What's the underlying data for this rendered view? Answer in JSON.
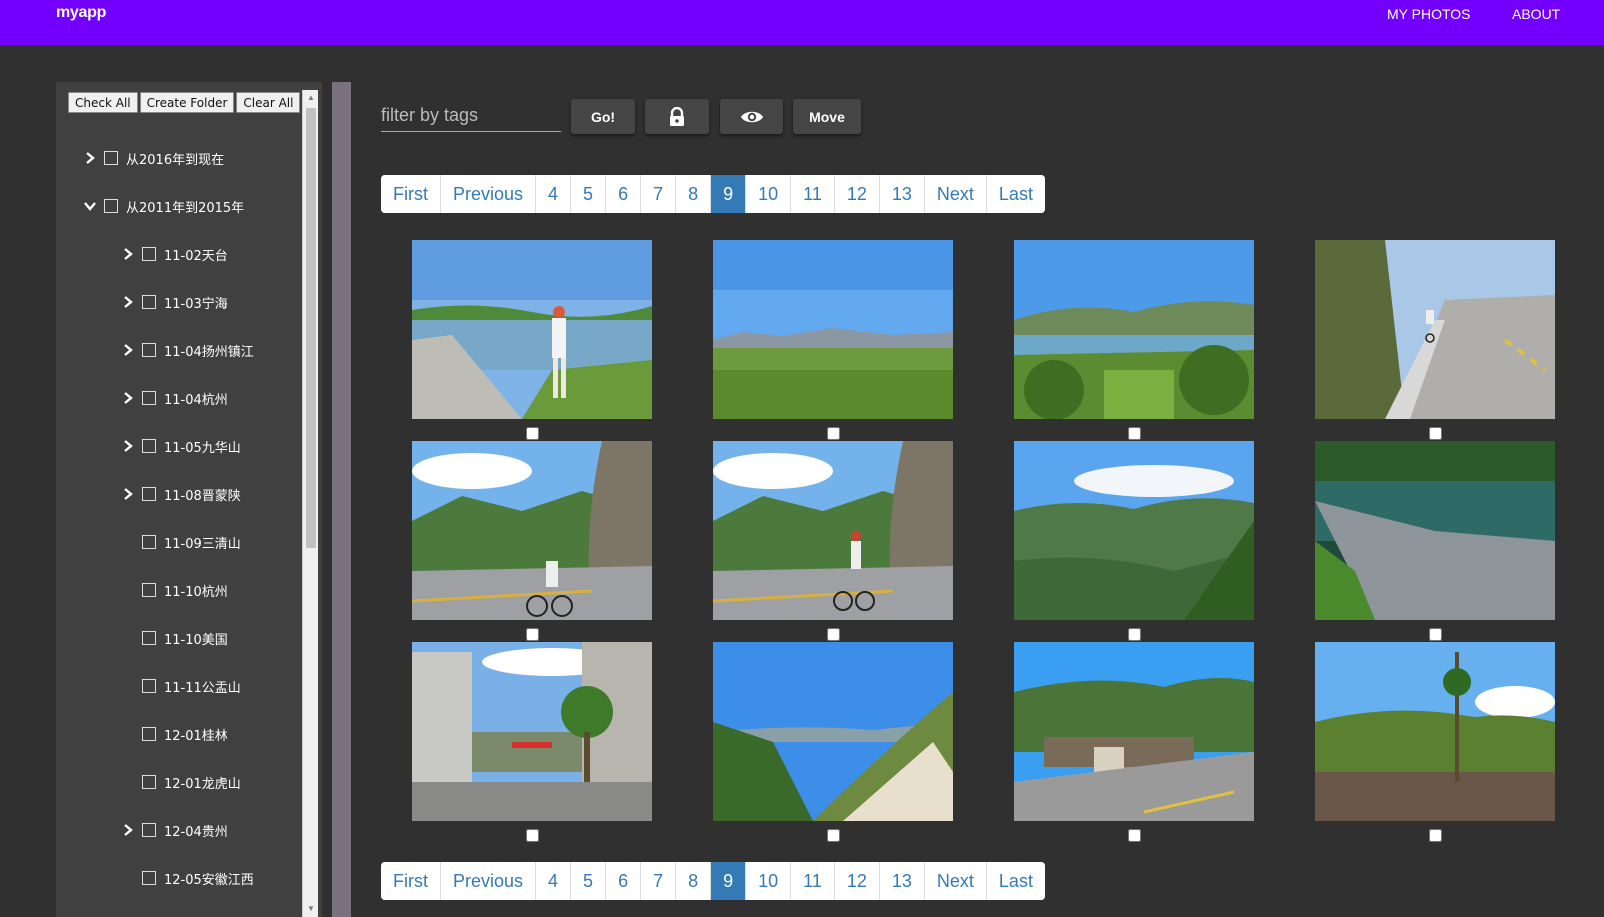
{
  "app": {
    "brand": "myapp"
  },
  "nav": {
    "photos": "MY PHOTOS",
    "about": "ABOUT"
  },
  "sidebar": {
    "toolbar": {
      "check_all": "Check All",
      "create_folder": "Create Folder",
      "clear_all": "Clear All"
    },
    "tree": [
      {
        "label": "从2016年到现在",
        "expander": "collapsed",
        "level": 0
      },
      {
        "label": "从2011年到2015年",
        "expander": "expanded",
        "level": 0
      },
      {
        "label": "11-02天台",
        "expander": "collapsed",
        "level": 1
      },
      {
        "label": "11-03宁海",
        "expander": "collapsed",
        "level": 1
      },
      {
        "label": "11-04扬州镇江",
        "expander": "collapsed",
        "level": 1
      },
      {
        "label": "11-04杭州",
        "expander": "collapsed",
        "level": 1
      },
      {
        "label": "11-05九华山",
        "expander": "collapsed",
        "level": 1
      },
      {
        "label": "11-08晋蒙陕",
        "expander": "collapsed",
        "level": 1
      },
      {
        "label": "11-09三清山",
        "expander": "none",
        "level": 1
      },
      {
        "label": "11-10杭州",
        "expander": "none",
        "level": 1
      },
      {
        "label": "11-10美国",
        "expander": "none",
        "level": 1
      },
      {
        "label": "11-11公盂山",
        "expander": "none",
        "level": 1
      },
      {
        "label": "12-01桂林",
        "expander": "none",
        "level": 1
      },
      {
        "label": "12-01龙虎山",
        "expander": "none",
        "level": 1
      },
      {
        "label": "12-04贵州",
        "expander": "collapsed",
        "level": 1
      },
      {
        "label": "12-05安徽江西",
        "expander": "none",
        "level": 1
      }
    ]
  },
  "filter": {
    "placeholder": "filter by tags",
    "go_label": "Go!",
    "lock_icon": "lock-icon",
    "eye_icon": "eye-icon",
    "move_label": "Move"
  },
  "pagination": {
    "items": [
      "First",
      "Previous",
      "4",
      "5",
      "6",
      "7",
      "8",
      "9",
      "10",
      "11",
      "12",
      "13",
      "Next",
      "Last"
    ],
    "active": "9"
  },
  "photos": [
    {
      "scene": "lake-person"
    },
    {
      "scene": "grass-field"
    },
    {
      "scene": "lake-valley"
    },
    {
      "scene": "road-cyclist"
    },
    {
      "scene": "mountain-cyclist"
    },
    {
      "scene": "mountain-cyclist-2"
    },
    {
      "scene": "green-valley"
    },
    {
      "scene": "river-shore"
    },
    {
      "scene": "town-street"
    },
    {
      "scene": "dry-slope"
    },
    {
      "scene": "road-bridge"
    },
    {
      "scene": "hill-tree"
    }
  ],
  "colors": {
    "topbar": "#7300ff",
    "page_bg": "#303030",
    "panel_bg": "#404040",
    "pager_active": "#337ab7",
    "pager_text": "#337ab7"
  }
}
